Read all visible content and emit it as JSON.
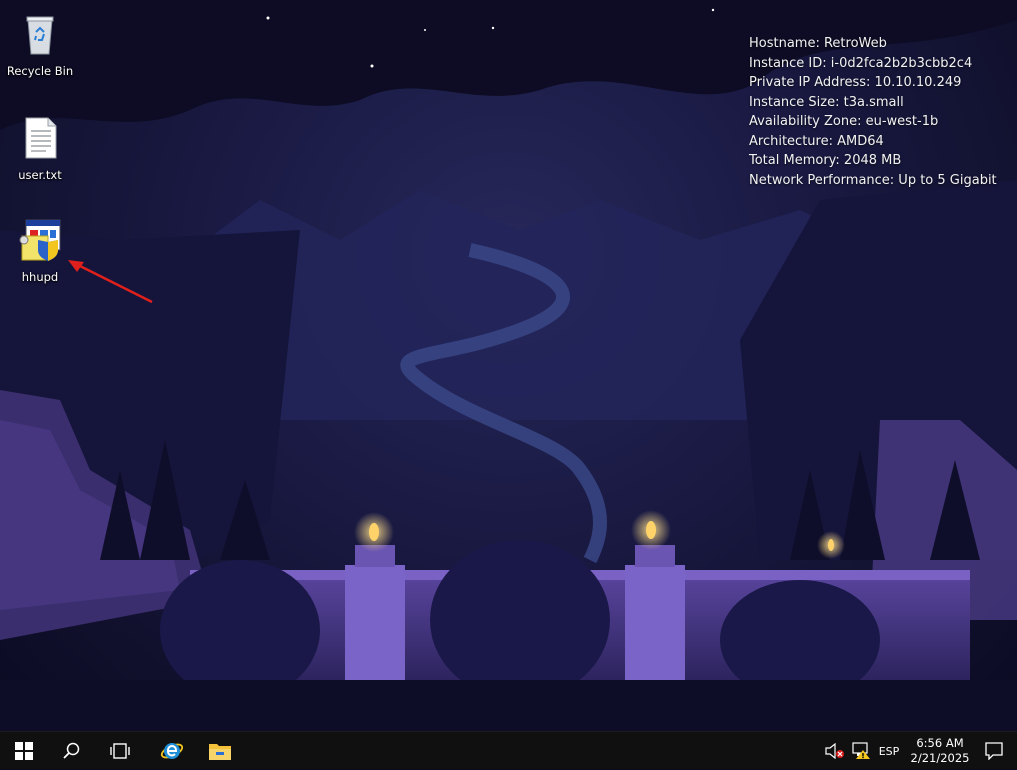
{
  "desktop": {
    "icons": [
      {
        "id": "recycle-bin",
        "label": "Recycle Bin",
        "icon": "recycle-bin-icon"
      },
      {
        "id": "user-txt",
        "label": "user.txt",
        "icon": "text-file-icon"
      },
      {
        "id": "hhupd",
        "label": "hhupd",
        "icon": "installer-shield-icon"
      }
    ],
    "annotation_arrow_color": "#e0201c"
  },
  "sysinfo": {
    "hostname": "Hostname: RetroWeb",
    "instance_id": "Instance ID: i-0d2fca2b2b3cbb2c4",
    "private_ip": "Private IP Address: 10.10.10.249",
    "instance_size": "Instance Size: t3a.small",
    "availability_zone": "Availability Zone: eu-west-1b",
    "architecture": "Architecture: AMD64",
    "total_memory": "Total Memory: 2048 MB",
    "network_performance": "Network Performance: Up to 5 Gigabit"
  },
  "taskbar": {
    "start_icon": "windows-logo-icon",
    "search_icon": "search-icon",
    "task_view_icon": "task-view-icon",
    "ie_icon": "internet-explorer-icon",
    "explorer_icon": "file-explorer-icon",
    "tray": {
      "volume_icon": "volume-muted-icon",
      "network_icon": "network-warning-icon",
      "language": "ESP",
      "time": "6:56 AM",
      "date": "2/21/2025",
      "notifications_icon": "action-center-icon"
    }
  },
  "colors": {
    "taskbar": "#101010",
    "ie_blue": "#1e8fd6",
    "folder_yellow": "#f3c23a",
    "candle": "#ffd36a"
  }
}
